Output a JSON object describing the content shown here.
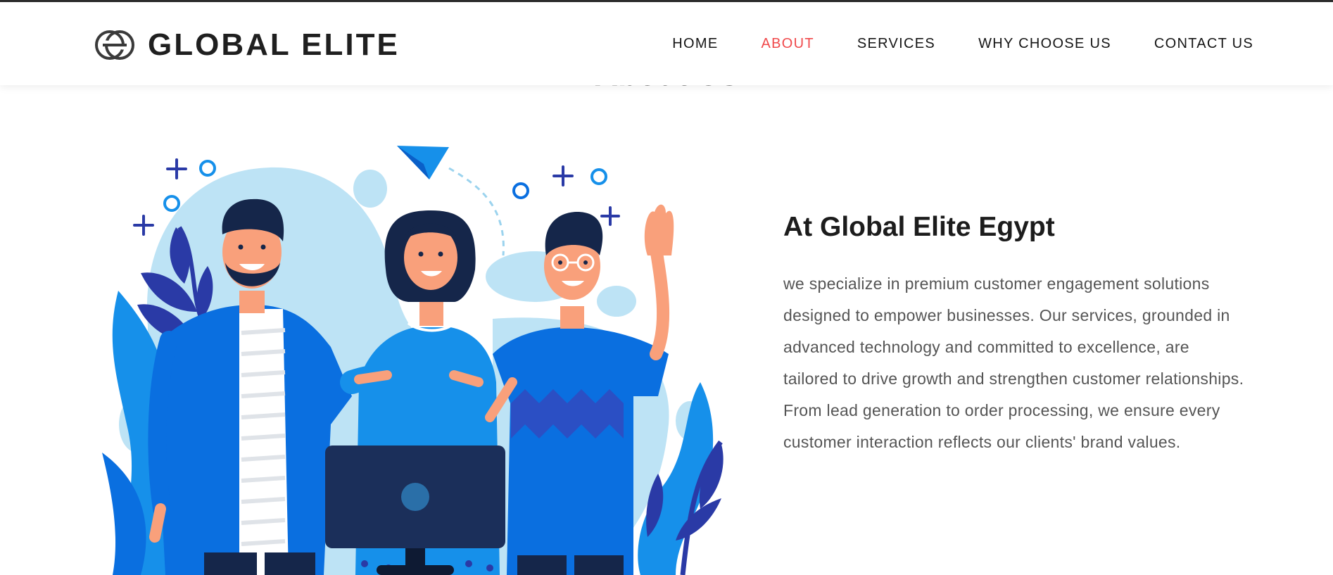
{
  "header": {
    "brand_name": "GLOBAL ELITE",
    "nav": [
      {
        "label": "HOME",
        "active": false
      },
      {
        "label": "ABOUT",
        "active": true
      },
      {
        "label": "SERVICES",
        "active": false
      },
      {
        "label": "WHY CHOOSE US",
        "active": false
      },
      {
        "label": "CONTACT US",
        "active": false
      }
    ]
  },
  "section": {
    "title": "About Us",
    "heading": "At Global Elite Egypt",
    "body": "we specialize in premium customer engagement solutions designed to empower businesses. Our services, grounded in advanced technology and committed to excellence, are tailored to drive growth and strengthen customer relationships. From lead generation to order processing, we ensure every customer interaction reflects our clients' brand values."
  },
  "colors": {
    "accent_active": "#f0494b",
    "primary_blue": "#0a6fe0",
    "light_blue": "#bde3f5",
    "navy": "#1b2f5a"
  },
  "icons": {
    "logo": "interlinked-rings-logo-icon",
    "illustration": "team-of-three-people-illustration"
  }
}
